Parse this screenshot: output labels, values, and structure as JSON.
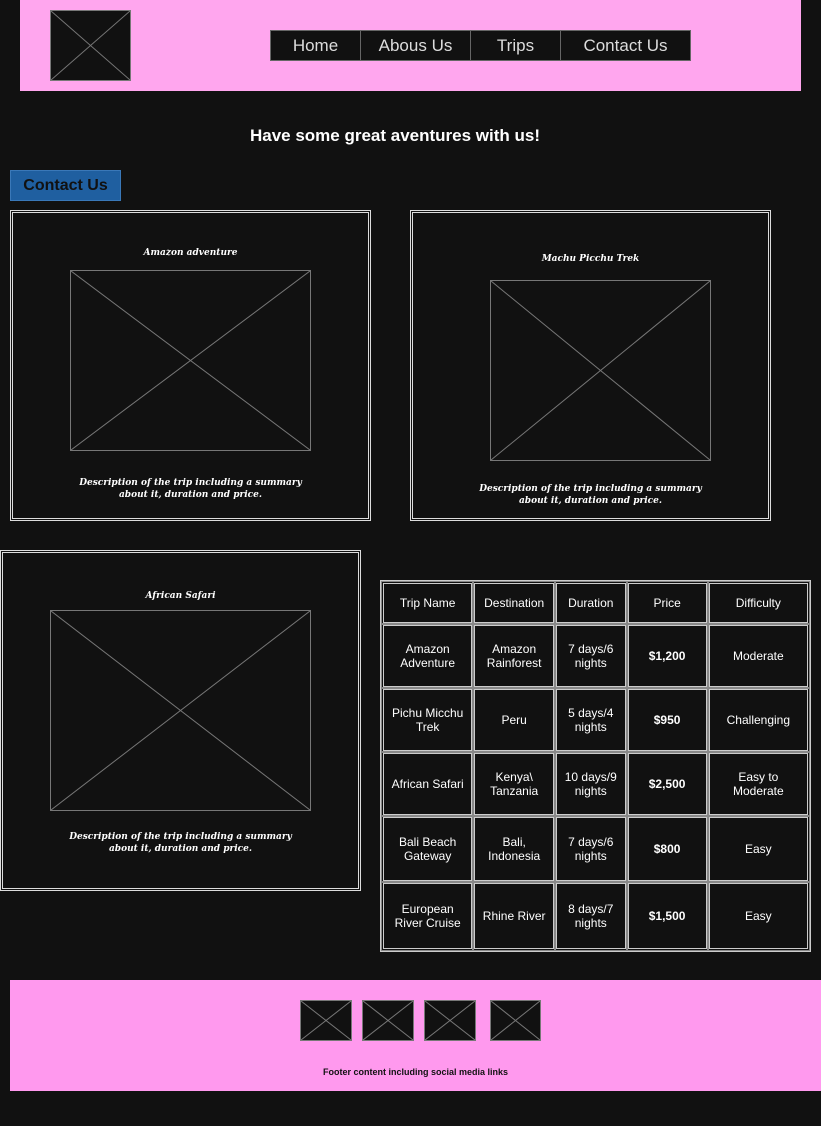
{
  "nav": {
    "items": [
      "Home",
      "Abous Us",
      "Trips",
      "Contact Us"
    ]
  },
  "headline": "Have some great aventures with us!",
  "contact_button": "Contact Us",
  "cards": [
    {
      "title": "Amazon adventure",
      "description": "Description of the trip including a summary about it, duration and price."
    },
    {
      "title": "Machu Picchu Trek",
      "description": "Description of the trip including a summary about it, duration and price."
    },
    {
      "title": "African Safari",
      "description": "Description of the trip including a summary about it, duration and price."
    }
  ],
  "table": {
    "headers": [
      "Trip Name",
      "Destination",
      "Duration",
      "Price",
      "Difficulty"
    ],
    "rows": [
      [
        "Amazon Adventure",
        "Amazon Rainforest",
        "7 days/6 nights",
        "$1,200",
        "Moderate"
      ],
      [
        "Pichu Micchu Trek",
        "Peru",
        "5 days/4 nights",
        "$950",
        "Challenging"
      ],
      [
        "African Safari",
        "Kenya\\ Tanzania",
        "10 days/9 nights",
        "$2,500",
        "Easy to Moderate"
      ],
      [
        "Bali Beach Gateway",
        "Bali, Indonesia",
        "7 days/6 nights",
        "$800",
        "Easy"
      ],
      [
        "European River Cruise",
        "Rhine River",
        "8 days/7 nights",
        "$1,500",
        "Easy"
      ]
    ]
  },
  "footer": {
    "text": "Footer content including social media links",
    "social_icons": [
      "social-icon-1",
      "social-icon-2",
      "social-icon-3",
      "social-icon-4"
    ]
  },
  "colors": {
    "background": "#111111",
    "header": "#ffa6ee",
    "footer": "#ff99ee",
    "contact_button": "#1f5fa0"
  }
}
